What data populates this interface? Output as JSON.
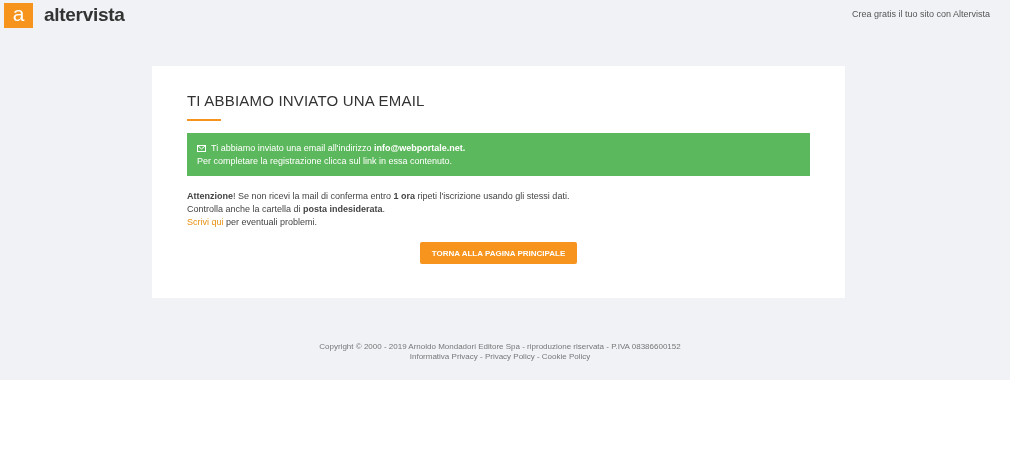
{
  "header": {
    "logo_letter": "a",
    "logo_text": "altervista",
    "link": "Crea gratis il tuo sito con Altervista"
  },
  "card": {
    "title": "TI ABBIAMO INVIATO UNA EMAIL",
    "alert": {
      "lines": [
        "Ti abbiamo inviato una email all'indirizzo **info@webportale.net.**",
        "Per completare la registrazione clicca sul link in essa contenuto."
      ]
    },
    "notes": [
      "**Attenzione**! Se non ricevi la mail di conferma entro **1 ora** ripeti l'iscrizione usando gli stessi dati.",
      "Controlla anche la cartella di **posta indesiderata**."
    ],
    "help": {
      "link": "Scrivi qui",
      "text": "per eventuali problemi."
    },
    "button": "TORNA ALLA PAGINA PRINCIPALE"
  },
  "footer": {
    "copyright": "Copyright © 2000 - 2019 Arnoldo Mondadori Editore Spa - riproduzione riservata - P.IVA 08386600152",
    "links": "Informativa Privacy - Privacy Policy - Cookie Policy"
  }
}
